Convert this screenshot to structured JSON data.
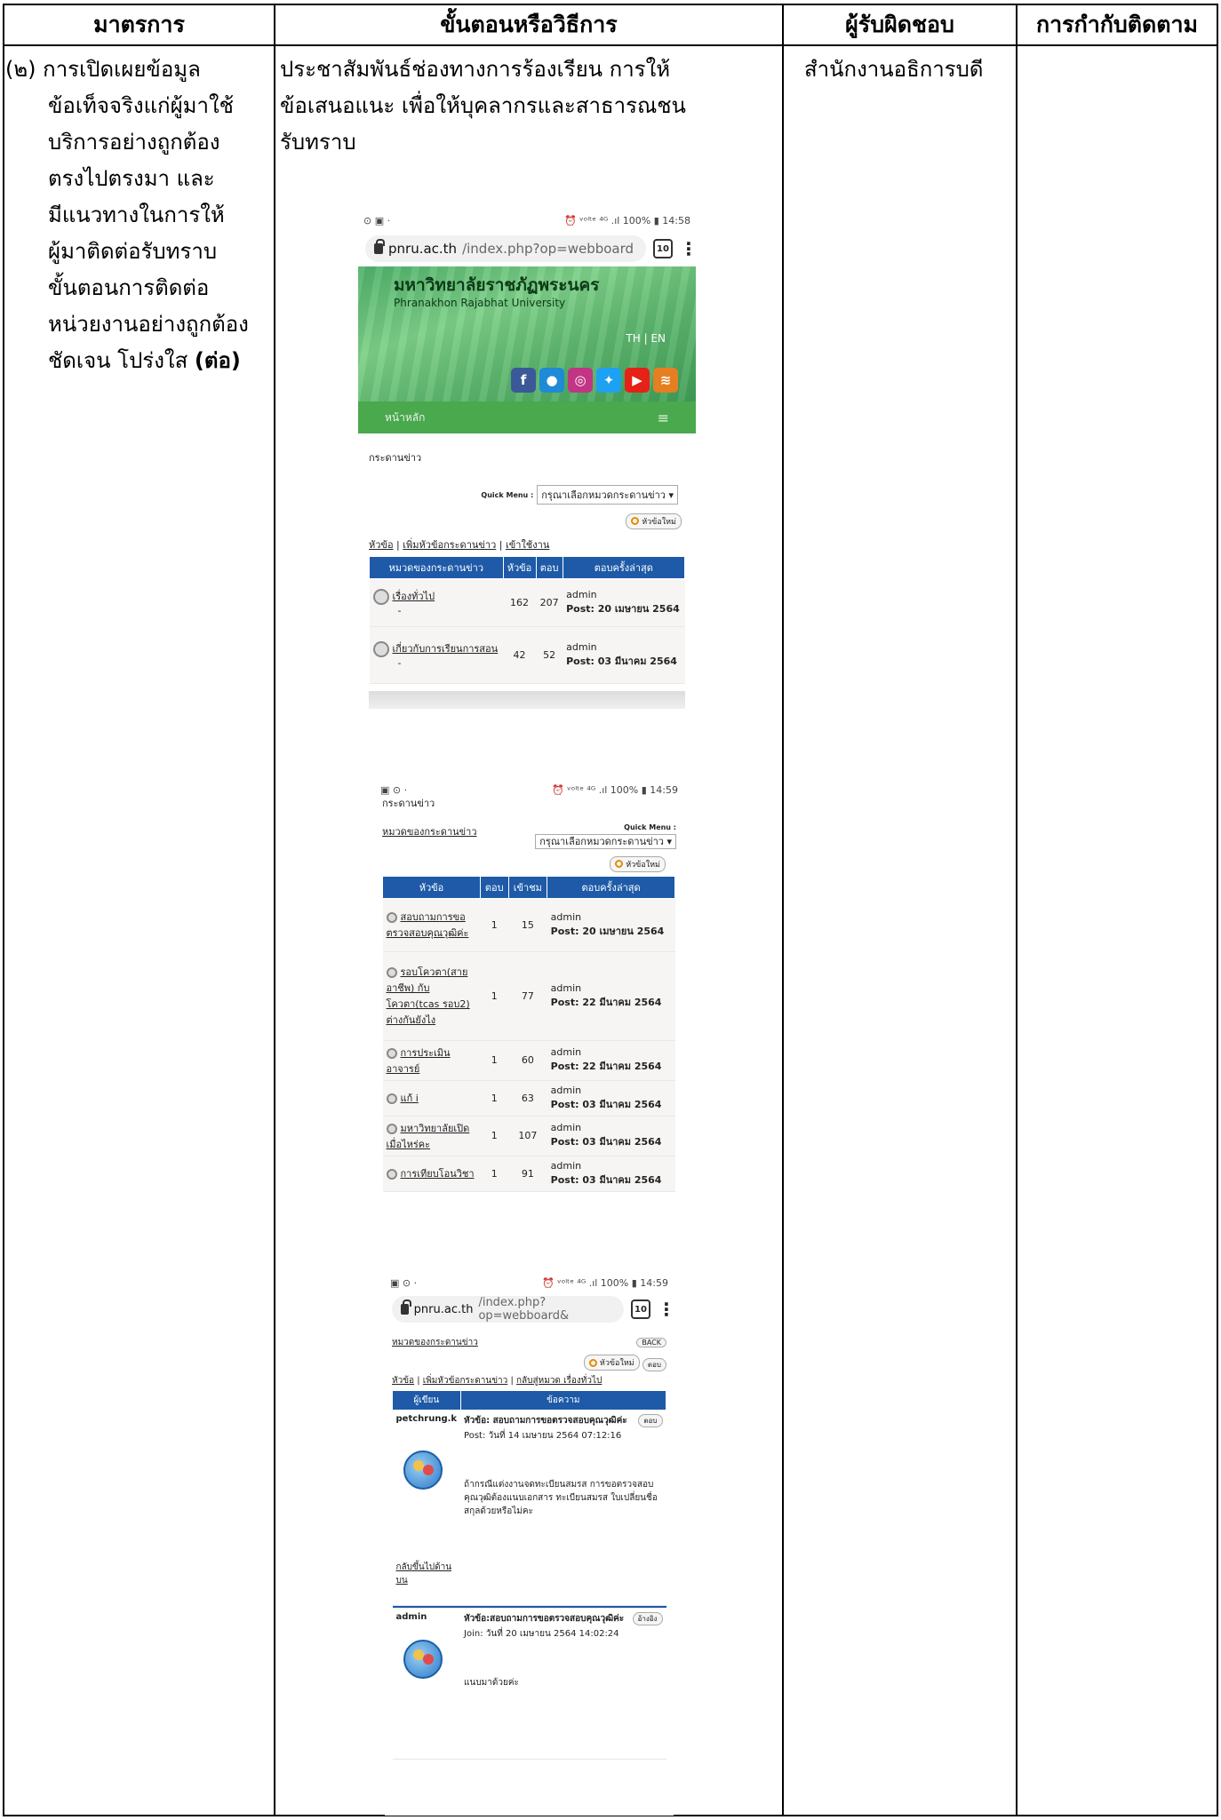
{
  "table": {
    "headers": [
      "มาตรการ",
      "ขั้นตอนหรือวิธีการ",
      "ผู้รับผิดชอบ",
      "การกำกับติดตาม"
    ],
    "measure_lines": [
      "(๒) การเปิดเผยข้อมูล",
      "ข้อเท็จจริงแก่ผู้มาใช้",
      "บริการอย่างถูกต้อง",
      "ตรงไปตรงมา และ",
      "มีแนวทางในการให้",
      "ผู้มาติดต่อรับทราบ",
      "ขั้นตอนการติดต่อ",
      "หน่วยงานอย่างถูกต้อง"
    ],
    "measure_last_plain": "ชัดเจน โปร่งใส ",
    "measure_last_bold": "(ต่อ)",
    "procedure_lines": [
      "ประชาสัมพันธ์ช่องทางการร้องเรียน การให้",
      "ข้อเสนอแนะ เพื่อให้บุคลากรและสาธารณชน",
      "รับทราบ"
    ],
    "responsible": "สำนักงานอธิการบดี",
    "monitoring": ""
  },
  "shot1": {
    "status_left": "⊙ ▣ ·",
    "status_right": "⏰ ᵛᵒˡᵗᵉ ⁴ᴳ .ıl 100% ▮ 14:58",
    "url_host": "pnru.ac.th",
    "url_path": "/index.php?op=webboard",
    "tabs": "10",
    "uni_th": "มหาวิทยาลัยราชภัฏพระนคร",
    "uni_en": "Phranakhon Rajabhat University",
    "lang": "TH | EN",
    "nav_home": "หน้าหลัก",
    "board_title": "กระดานข่าว",
    "quick_menu_label": "Quick Menu :",
    "quick_menu_value": "กรุณาเลือกหมวดกระดานข่าว ▾",
    "new_topic": "หัวข้อใหม่",
    "links": [
      "หัวข้อ",
      "เพิ่มหัวข้อกระดานข่าว",
      "เข้าใช้งาน"
    ],
    "columns": [
      "หมวดของกระดานข่าว",
      "หัวข้อ",
      "ตอบ",
      "ตอบครั้งล่าสุด"
    ],
    "rows": [
      {
        "name": "เรื่องทั่วไป",
        "suffix": "-",
        "topics": "162",
        "replies": "207",
        "by": "admin",
        "post": "Post: 20 เมษายน 2564"
      },
      {
        "name": "เกี่ยวกับการเรียนการสอน",
        "suffix": "-",
        "topics": "42",
        "replies": "52",
        "by": "admin",
        "post": "Post: 03 มีนาคม 2564"
      }
    ]
  },
  "shot2": {
    "status_left": "▣ ⊙ ·",
    "status_right": "⏰ ᵛᵒˡᵗᵉ ⁴ᴳ .ıl 100% ▮ 14:59",
    "board_title": "กระดานข่าว",
    "category_link": "หมวดของกระดานข่าว",
    "quick_menu_label": "Quick Menu :",
    "quick_menu_value": "กรุณาเลือกหมวดกระดานข่าว ▾",
    "new_topic": "หัวข้อใหม่",
    "columns": [
      "หัวข้อ",
      "ตอบ",
      "เข้าชม",
      "ตอบครั้งล่าสุด"
    ],
    "rows": [
      {
        "title": "สอบถามการขอตรวจสอบคุณวุฒิค่ะ",
        "replies": "1",
        "views": "15",
        "by": "admin",
        "post": "Post: 20 เมษายน 2564"
      },
      {
        "title": "รอบโควตา(สายอาชีพ) กับ โควตา(tcas รอบ2) ต่างกันยังไง",
        "replies": "1",
        "views": "77",
        "by": "admin",
        "post": "Post: 22 มีนาคม 2564"
      },
      {
        "title": "การประเมินอาจารย์",
        "replies": "1",
        "views": "60",
        "by": "admin",
        "post": "Post: 22 มีนาคม 2564"
      },
      {
        "title": "แก้ i",
        "replies": "1",
        "views": "63",
        "by": "admin",
        "post": "Post: 03 มีนาคม 2564"
      },
      {
        "title": "มหาวิทยาลัยเปิดเมื่อไหร่คะ",
        "replies": "1",
        "views": "107",
        "by": "admin",
        "post": "Post: 03 มีนาคม 2564"
      },
      {
        "title": "การเทียบโอนวิชา",
        "replies": "1",
        "views": "91",
        "by": "admin",
        "post": "Post: 03 มีนาคม 2564"
      }
    ]
  },
  "shot3": {
    "status_left": "▣ ⊙ ·",
    "status_right": "⏰ ᵛᵒˡᵗᵉ ⁴ᴳ .ıl 100% ▮ 14:59",
    "url_host": "pnru.ac.th",
    "url_path": "/index.php?op=webboard&",
    "tabs": "10",
    "category_link": "หมวดของกระดานข่าว",
    "back": "BACK",
    "new_topic": "หัวข้อใหม่",
    "reply": "ตอบ",
    "links": [
      "หัวข้อ",
      "เพิ่มหัวข้อกระดานข่าว",
      "กลับสู่หมวด เรื่องทั่วไป"
    ],
    "columns": [
      "ผู้เขียน",
      "ข้อความ"
    ],
    "post1": {
      "author": "petchrung.k",
      "topic": "หัวข้อ: สอบถามการขอตรวจสอบคุณวุฒิค่ะ",
      "date": "Post: วันที่ 14 เมษายน 2564 07:12:16",
      "body": "ถ้ากรณีแต่งงานจดทะเบียนสมรส การขอตรวจสอบคุณวุฒิต้องแนบเอกสาร ทะเบียนสมรส ใบเปลี่ยนชื่อสกุลด้วยหรือไม่คะ",
      "back_top": "กลับขึ้นไปด้านบน"
    },
    "post2": {
      "author": "admin",
      "topic": "หัวข้อ:สอบถามการขอตรวจสอบคุณวุฒิค่ะ",
      "date": "Join: วันที่ 20 เมษายน 2564 14:02:24",
      "quote": "อ้างอิง",
      "body": "แนบมาด้วยค่ะ"
    }
  },
  "colors": {
    "header_blue": "#1e5aa8",
    "nav_green": "#4aa84d",
    "banner_green": "#5fb86f"
  }
}
